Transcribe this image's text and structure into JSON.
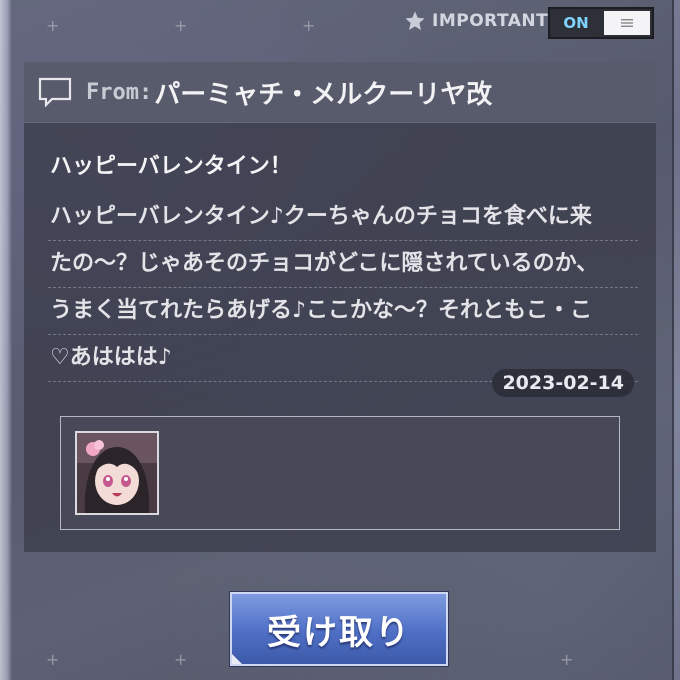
{
  "header": {
    "important_label": "IMPORTANT",
    "toggle_on_label": "ON"
  },
  "message": {
    "from_prefix": "From:",
    "from_name": "パーミャチ・メルクーリヤ改",
    "title": "ハッピーバレンタイン！",
    "body_lines": [
      "ハッピーバレンタイン♪クーちゃんのチョコを食べに来",
      "たの～？じゃあそのチョコがどこに隠されているのか、",
      "うまく当てれたらあげる♪ここかな～？それともこ・こ",
      "♡あははは♪"
    ],
    "date": "2023-02-14"
  },
  "attachment": {
    "icon": "character-portrait-icon"
  },
  "receive_button": {
    "label": "受け取り"
  },
  "colors": {
    "toggle_on": "#7fd3ff",
    "button": "#4f6fc6"
  }
}
